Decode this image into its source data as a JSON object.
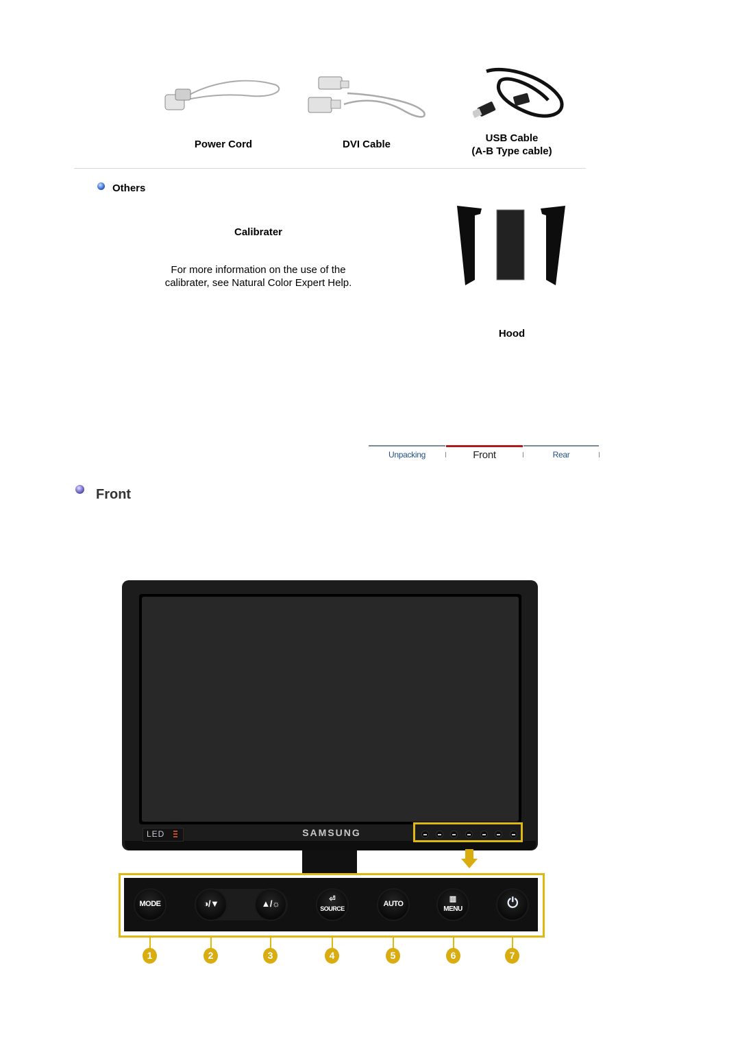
{
  "accessories": [
    {
      "label": "Power Cord",
      "icon": "power-cord-image"
    },
    {
      "label": "DVI Cable",
      "icon": "dvi-cable-image"
    },
    {
      "label_line1": "USB Cable",
      "label_line2": "(A-B Type cable)",
      "icon": "usb-cable-image"
    }
  ],
  "others": {
    "heading": "Others",
    "calibrater": {
      "title": "Calibrater",
      "description_line1": "For more information on the use of the",
      "description_line2": "calibrater, see Natural Color Expert Help."
    },
    "hood": {
      "label": "Hood",
      "icon": "hood-image"
    }
  },
  "tabs": [
    {
      "label": "Unpacking",
      "active": false
    },
    {
      "label": "Front",
      "active": true
    },
    {
      "label": "Rear",
      "active": false
    }
  ],
  "section": {
    "title": "Front"
  },
  "monitor": {
    "brand": "SAMSUNG",
    "led_badge": "LED",
    "screen_color": "#282828",
    "highlight_color": "#e0b812"
  },
  "controls": [
    {
      "number": "1",
      "label": "MODE",
      "icon": "mode-button"
    },
    {
      "number": "2",
      "label": "◑/▼",
      "icon": "contrast-down-button"
    },
    {
      "number": "3",
      "label": "▲/☼",
      "icon": "up-brightness-button"
    },
    {
      "number": "4",
      "label": "SOURCE",
      "icon": "source-button",
      "glyph": "⏎"
    },
    {
      "number": "5",
      "label": "AUTO",
      "icon": "auto-button"
    },
    {
      "number": "6",
      "label": "MENU",
      "icon": "menu-button",
      "glyph": "▥"
    },
    {
      "number": "7",
      "label": "⏻",
      "icon": "power-button"
    }
  ]
}
